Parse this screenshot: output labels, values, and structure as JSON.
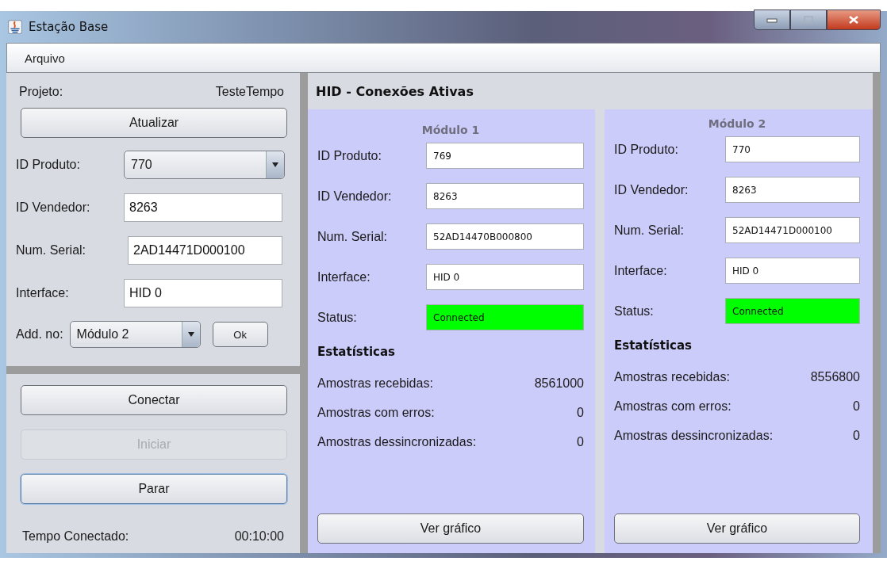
{
  "window": {
    "title": "Estação Base"
  },
  "menu": [
    "Arquivo"
  ],
  "left_panel": {
    "project": {
      "label": "Projeto:",
      "value": "TesteTempo"
    },
    "refresh_button": {
      "label": "Atualizar",
      "disabled": false
    },
    "fields": [
      {
        "kind": "combo",
        "label": "ID Produto:",
        "value": "770"
      },
      {
        "kind": "text",
        "label": "ID Vendedor:",
        "value": "8263"
      },
      {
        "kind": "text",
        "label": "Num. Serial:",
        "value": "2AD14471D000100"
      },
      {
        "kind": "text",
        "label": "Interface:",
        "value": "HID 0"
      }
    ],
    "add_to": {
      "label": "Add. no:",
      "value": "Módulo 2",
      "button": "Ok"
    },
    "buttons": [
      {
        "label": "Conectar",
        "disabled": false,
        "focused": false
      },
      {
        "label": "Iniciar",
        "disabled": true,
        "focused": false
      },
      {
        "label": "Parar",
        "disabled": false,
        "focused": true
      }
    ],
    "connected_time": {
      "label": "Tempo Conectado:",
      "value": "00:10:00"
    }
  },
  "right_panel": {
    "title": "HID - Conexões Ativas",
    "modules": [
      {
        "title": "Módulo 1",
        "fields": [
          {
            "label": "ID Produto:",
            "value": "769"
          },
          {
            "label": "ID Vendedor:",
            "value": "8263"
          },
          {
            "label": "Num. Serial:",
            "value": "52AD14470B000800"
          },
          {
            "label": "Interface:",
            "value": "HID 0"
          }
        ],
        "status": {
          "label": "Status:",
          "value": "Connected",
          "color": "#00ff00"
        },
        "stats_title": "Estatísticas",
        "stats": [
          {
            "label": "Amostras recebidas:",
            "value": "8561000"
          },
          {
            "label": "Amostras com erros:",
            "value": "0"
          },
          {
            "label": "Amostras dessincronizadas:",
            "value": "0"
          }
        ],
        "chart_button": "Ver gráfico"
      },
      {
        "title": "Módulo 2",
        "fields": [
          {
            "label": "ID Produto:",
            "value": "770"
          },
          {
            "label": "ID Vendedor:",
            "value": "8263"
          },
          {
            "label": "Num. Serial:",
            "value": "52AD14471D000100"
          },
          {
            "label": "Interface:",
            "value": "HID 0"
          }
        ],
        "status": {
          "label": "Status:",
          "value": "Connected",
          "color": "#00ff00"
        },
        "stats_title": "Estatísticas",
        "stats": [
          {
            "label": "Amostras recebidas:",
            "value": "8556800"
          },
          {
            "label": "Amostras com erros:",
            "value": "0"
          },
          {
            "label": "Amostras dessincronizadas:",
            "value": "0"
          }
        ],
        "chart_button": "Ver gráfico"
      }
    ]
  }
}
